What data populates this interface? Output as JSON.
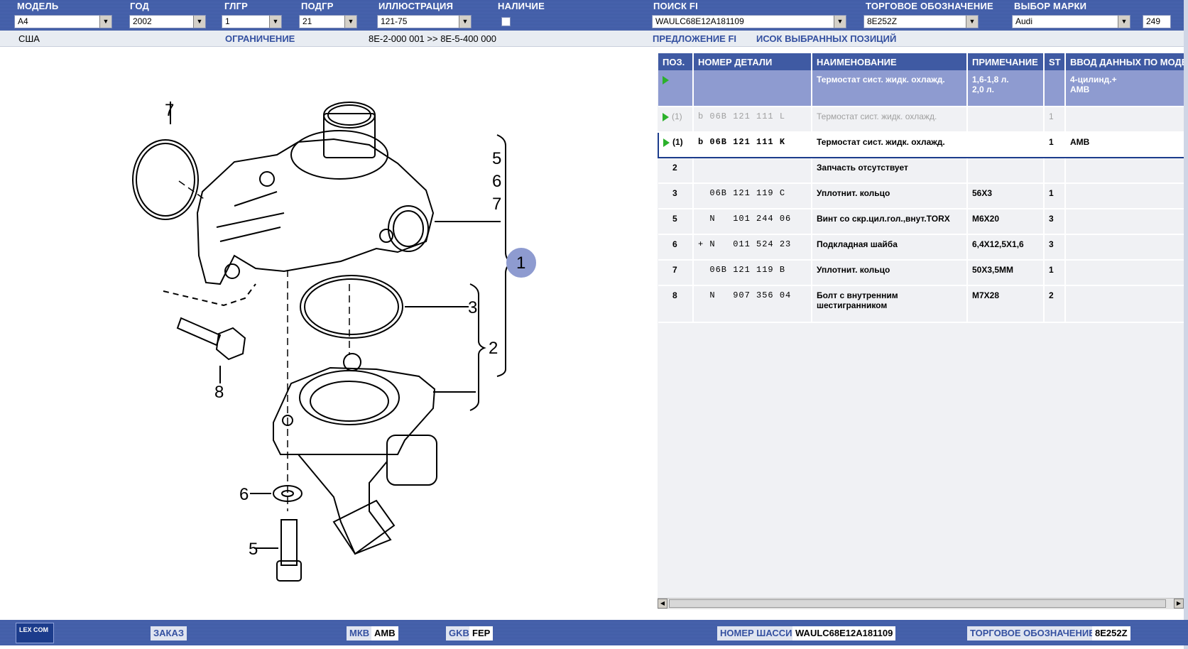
{
  "toolbar": {
    "model_label": "МОДЕЛЬ",
    "model_value": "A4",
    "year_label": "ГОД",
    "year_value": "2002",
    "glgr_label": "ГЛГР",
    "glgr_value": "1",
    "podgr_label": "ПОДГР",
    "podgr_value": "21",
    "illustration_label": "ИЛЛЮСТРАЦИЯ",
    "illustration_value": "121-75",
    "availability_label": "НАЛИЧИЕ",
    "search_fi_label": "ПОИСК FI",
    "search_fi_value": "WAULC68E12A181109",
    "trade_label": "ТОРГОВОЕ ОБОЗНАЧЕНИЕ",
    "trade_value": "8E252Z",
    "brand_label": "ВЫБОР МАРКИ",
    "brand_value": "Audi",
    "page_number": "249"
  },
  "subbar": {
    "region": "США",
    "restriction_label": "ОГРАНИЧЕНИЕ",
    "range": "8E-2-000 001 >> 8E-5-400 000",
    "proposal_label": "ПРЕДЛОЖЕНИЕ FI",
    "selected_list_label": "ИСОК ВЫБРАННЫХ ПОЗИЦИЙ"
  },
  "drawing": {
    "callouts": [
      "7",
      "5",
      "6",
      "7",
      "1",
      "3",
      "2",
      "8",
      "6",
      "5"
    ]
  },
  "table": {
    "headers": [
      "ПОЗ.",
      "НОМЕР ДЕТАЛИ",
      "НАИМЕНОВАНИЕ",
      "ПРИМЕЧАНИЕ",
      "ST",
      "ВВОД ДАННЫХ ПО МОДЕ"
    ],
    "rows": [
      {
        "pos": "",
        "part": "",
        "name": "Термостат сист. жидк. охлажд.",
        "note": "1,6-1,8 л.",
        "note2": "2,0 л.",
        "st": "",
        "data": "4-цилинд.+",
        "data2": "AMB"
      },
      {
        "pos": "(1)",
        "part": "b 06B 121 111 L",
        "name": "Термостат сист. жидк. охлажд.",
        "note": "",
        "note2": "",
        "st": "1",
        "data": "",
        "data2": ""
      },
      {
        "pos": "(1)",
        "part": "b 06B 121 111 K",
        "name": "Термостат сист. жидк. охлажд.",
        "note": "",
        "note2": "",
        "st": "1",
        "data": "AMB",
        "data2": ""
      },
      {
        "pos": "2",
        "part": "",
        "name": "Запчасть отсутствует",
        "note": "",
        "note2": "",
        "st": "",
        "data": "",
        "data2": ""
      },
      {
        "pos": "3",
        "part": "  06B 121 119 C",
        "name": "Уплотнит. кольцо",
        "note": "56X3",
        "note2": "",
        "st": "1",
        "data": "",
        "data2": ""
      },
      {
        "pos": "5",
        "part": "  N   101 244 06",
        "name": "Винт со скр.цил.гол.,внут.TORX",
        "note": "M6X20",
        "note2": "",
        "st": "3",
        "data": "",
        "data2": ""
      },
      {
        "pos": "6",
        "part": "+ N   011 524 23",
        "name": "Подкладная шайба",
        "note": "6,4X12,5X1,6",
        "note2": "",
        "st": "3",
        "data": "",
        "data2": ""
      },
      {
        "pos": "7",
        "part": "  06B 121 119 B",
        "name": "Уплотнит. кольцо",
        "note": "50X3,5MM",
        "note2": "",
        "st": "1",
        "data": "",
        "data2": ""
      },
      {
        "pos": "8",
        "part": "  N   907 356 04",
        "name": "Болт с внутренним",
        "name2": "шестигранником",
        "note": "M7X28",
        "note2": "",
        "st": "2",
        "data": "",
        "data2": ""
      }
    ]
  },
  "bottom": {
    "logo_text": "LEX COM",
    "order_label": "ЗАКАЗ",
    "mkb_label": "МКВ",
    "mkb_value": "AMB",
    "gkb_label": "GKB",
    "gkb_value": "FEP",
    "chassis_label": "НОМЕР ШАССИ",
    "chassis_value": "WAULC68E12A181109",
    "trade_label": "ТОРГОВОЕ ОБОЗНАЧЕНИЕ",
    "trade_value": "8E252Z"
  },
  "colors": {
    "header_blue": "#3f5aa3",
    "highlight_row": "#8e9bd0",
    "play_green": "#2bb12b"
  }
}
